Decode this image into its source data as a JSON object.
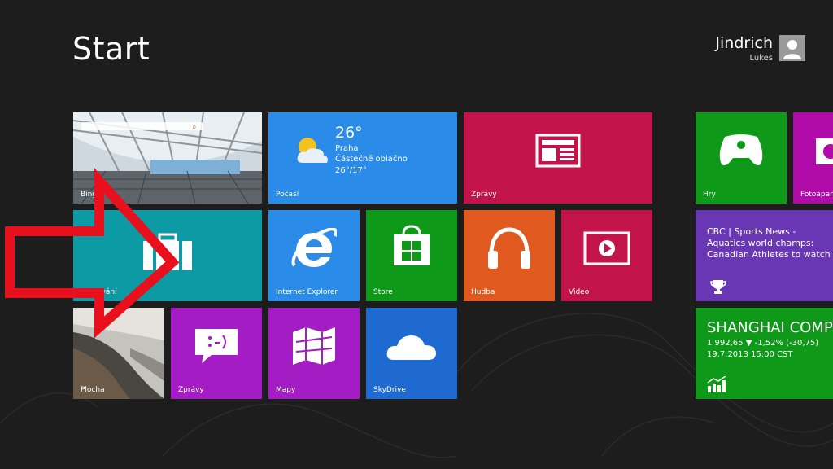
{
  "header": {
    "title": "Start"
  },
  "user": {
    "first_name": "Jindrich",
    "last_name": "Lukes"
  },
  "tiles": {
    "bing": "Bing",
    "weather": {
      "label": "Počasí",
      "temp": "26°",
      "city": "Praha",
      "condition": "Částečně oblačno",
      "range": "26°/17°"
    },
    "news": "Zprávy",
    "games": "Hry",
    "camera": "Fotoaparát",
    "travel": "Cestování",
    "ie": "Internet Explorer",
    "store": "Store",
    "music": "Hudba",
    "video": "Video",
    "sports": {
      "text": "CBC | Sports News - Aquatics world champs: Canadian Athletes to watch"
    },
    "desktop": "Plocha",
    "messaging": "Zprávy",
    "maps": "Mapy",
    "skydrive": "SkyDrive",
    "finance": {
      "title": "SHANGHAI COMPOSITE",
      "value": "1 992,65 ▼ -1,52% (-30,75)",
      "time": "19.7.2013 15:00 CST"
    }
  },
  "colors": {
    "background": "#1d1d1d",
    "weather": "#2a8ce8",
    "news": "#c2144a",
    "games": "#0e9a18",
    "camera": "#b00ba8",
    "travel": "#0c9aa5",
    "ie": "#2a8ce8",
    "store": "#0e9a18",
    "music": "#e05a1f",
    "video": "#c2144a",
    "sports": "#6a37b4",
    "messaging": "#a31cc4",
    "maps": "#a31cc4",
    "skydrive": "#1f6ad0",
    "finance": "#0e9a18",
    "arrow": "#e8101c"
  }
}
